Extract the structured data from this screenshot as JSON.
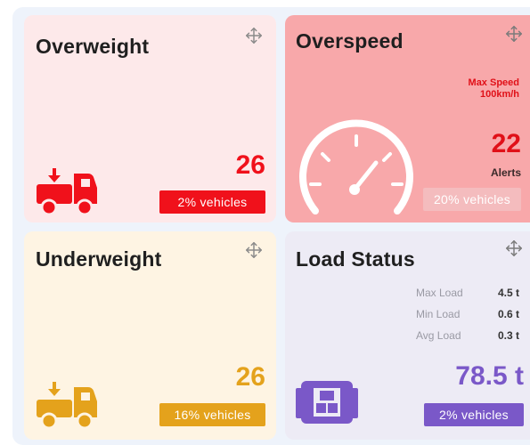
{
  "cards": {
    "overweight": {
      "title": "Overweight",
      "value": "26",
      "badge": "2% vehicles",
      "accent": "#f0111b",
      "icon": "truck-icon"
    },
    "overspeed": {
      "title": "Overspeed",
      "max_speed_label": "Max Speed",
      "max_speed_value": "100km/h",
      "value": "22",
      "value_caption": "Alerts",
      "badge": "20% vehicles",
      "accent": "#f0111b",
      "icon": "speedometer-icon"
    },
    "underweight": {
      "title": "Underweight",
      "value": "26",
      "badge": "16% vehicles",
      "accent": "#e4a21c",
      "icon": "truck-icon"
    },
    "load_status": {
      "title": "Load Status",
      "rows": [
        {
          "label": "Max Load",
          "value": "4.5 t"
        },
        {
          "label": "Min Load",
          "value": "0.6 t"
        },
        {
          "label": "Avg Load",
          "value": "0.3 t"
        }
      ],
      "value": "78.5 t",
      "badge": "2% vehicles",
      "accent": "#7a58c8",
      "icon": "container-icon"
    }
  },
  "icons": {
    "move": "move-icon"
  }
}
